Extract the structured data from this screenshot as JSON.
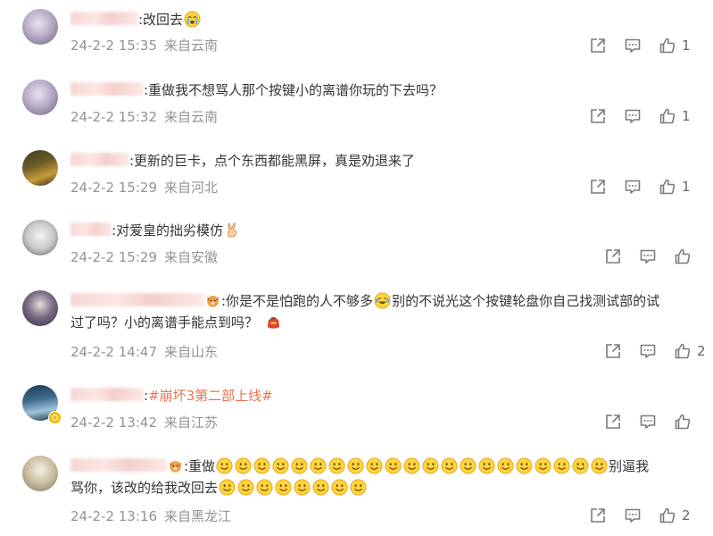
{
  "comments": [
    {
      "text": ":改回去",
      "time": "24-2-2 15:35",
      "location": "来自云南",
      "likes": "1",
      "emoji": "crying-face"
    },
    {
      "text": ":重做我不想骂人那个按键小的离谱你玩的下去吗？",
      "time": "24-2-2 15:32",
      "location": "来自云南",
      "likes": "1"
    },
    {
      "text": ":更新的巨卡，点个东西都能黑屏，真是劝退来了",
      "time": "24-2-2 15:29",
      "location": "来自河北",
      "likes": "1"
    },
    {
      "text": ":对爱皇的拙劣模仿",
      "time": "24-2-2 15:29",
      "location": "来自安徽",
      "likes": "",
      "emoji": "victory-hand"
    },
    {
      "text_a": ":你是不是怕跑的人不够多",
      "text_b": "别的不说光这个按键轮盘你自己找测试部的试",
      "text_c": "过了吗？小的离谱手能点到吗？",
      "time": "24-2-2 14:47",
      "location": "来自山东",
      "likes": "2"
    },
    {
      "sep": ":",
      "tag": "#崩坏3第二部上线#",
      "time": "24-2-2 13:42",
      "location": "来自江苏",
      "likes": ""
    },
    {
      "text_a": ":重做",
      "text_b": "别逼我",
      "text_c": "骂你，该改的给我改回去",
      "time": "24-2-2 13:16",
      "location": "来自黑龙江",
      "likes": "2"
    }
  ],
  "icons": {
    "share": "share-icon",
    "reply": "comment-icon",
    "like": "thumbs-up-icon",
    "verified": "verified-badge-icon"
  },
  "colors": {
    "text": "#333333",
    "meta": "#939393",
    "tag": "#eb7350",
    "icon": "#7b7b7b",
    "verified": "#f5b800"
  }
}
